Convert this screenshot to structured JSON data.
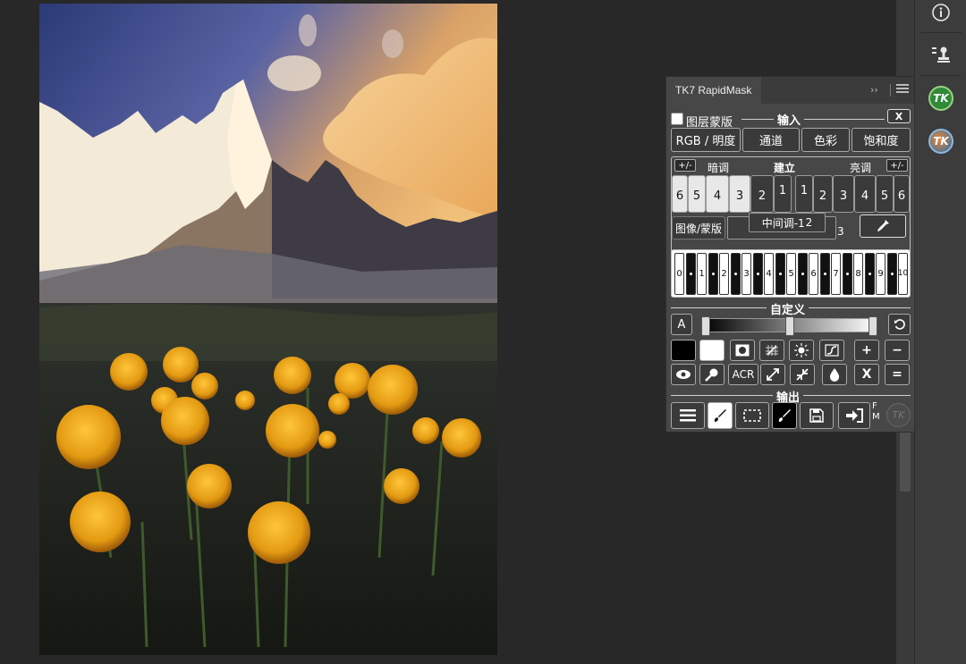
{
  "panel": {
    "tab_title": "TK7 RapidMask",
    "collapse_glyph": "››",
    "input": {
      "layer_mask_label": "图层蒙版",
      "section_title": "输入",
      "close_label": "X",
      "rgb_button": "RGB / 明度",
      "channel_button": "通道",
      "color_button": "色彩",
      "saturation_button": "饱和度"
    },
    "tones": {
      "darks_pm": "+/-",
      "darks_label": "暗调",
      "build_label": "建立",
      "lights_label": "亮调",
      "lights_pm": "+/-",
      "dark_zones": [
        "6",
        "5",
        "4",
        "3",
        "2",
        "1"
      ],
      "light_zones": [
        "1",
        "2",
        "3",
        "4",
        "5",
        "6"
      ],
      "image_mask_label": "图像/蒙版",
      "midtone_label": "中间调-1",
      "midtone_suffix_2": "2",
      "midtone_suffix_3": "3"
    },
    "piano_keys": [
      "0",
      "1",
      "2",
      "3",
      "4",
      "5",
      "6",
      "7",
      "8",
      "9",
      "10"
    ],
    "custom": {
      "section_title": "自定义",
      "a_button": "A",
      "reset_icon": "rotate-left-icon"
    },
    "tools_row_1": [
      "black-swatch",
      "white-swatch",
      "circle-mask-icon",
      "grid-icon",
      "sun-icon",
      "contrast-icon",
      "+",
      "−"
    ],
    "tools_row_2": {
      "acr_label": "ACR",
      "x_label": "X",
      "equals_label": "="
    },
    "output": {
      "section_title": "输出",
      "fm_label": "F\nM",
      "tk_logo": "TK"
    }
  },
  "dock": {
    "items": [
      "info-icon",
      "stamp-icon",
      "tk7-green-logo",
      "tk7-blue-logo"
    ],
    "tk_label": "TK"
  }
}
